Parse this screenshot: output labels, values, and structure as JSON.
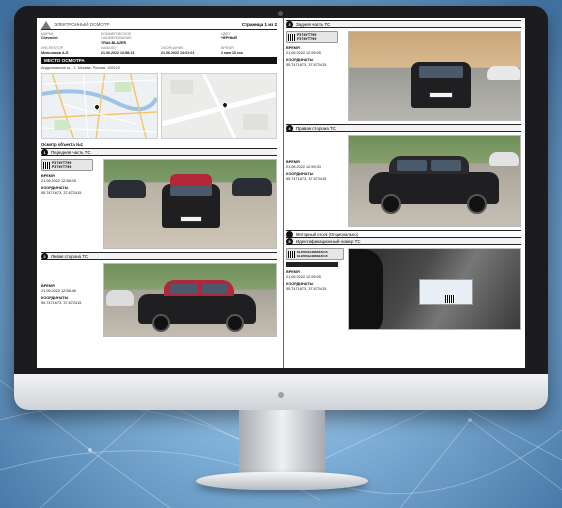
{
  "header": {
    "brand": "ЭЛЕКТРОННЫЙ ОСМОТР",
    "page": "Страница 1 из 2"
  },
  "meta": [
    {
      "label": "Марка",
      "value": "Chevrolet"
    },
    {
      "label": "Коммерческое наименование",
      "value": "TRAILBLAZER"
    },
    {
      "label": "",
      "value": ""
    },
    {
      "label": "Цвет",
      "value": "ЧЕРНЫЙ"
    },
    {
      "label": "Инспектор",
      "value": "Мельников А.Л."
    },
    {
      "label": "Начало",
      "value": "21.06.2022 12:58:13"
    },
    {
      "label": "Окончание",
      "value": "21.06.2022 13:01:01"
    },
    {
      "label": "Время",
      "value": "2 мин 10 сек"
    }
  ],
  "place": {
    "title": "МЕСТО ОСМОТРА",
    "address": "Андроновское ш., 2, Москва, Россия, 105120"
  },
  "object_label": "Осмотр объекта №1",
  "photos": [
    {
      "num": "1",
      "title": "Передняя часть ТС",
      "plate1": "P376YT799",
      "plate2": "P376YT799",
      "time_label": "ВРЕМЯ",
      "time": "21.06.2022 12:58:05",
      "coords_label": "КООРДИНАТЫ",
      "coords": "55.747167З, 37.672415"
    },
    {
      "num": "2",
      "title": "Левая сторона ТС",
      "time_label": "ВРЕМЯ",
      "time": "21.06.2022 12:58:46",
      "coords_label": "КООРДИНАТЫ",
      "coords": "55.747167З, 37.672415"
    },
    {
      "num": "3",
      "title": "Задняя часть ТС",
      "plate1": "P376YT799",
      "plate2": "P376YT799",
      "time_label": "ВРЕМЯ",
      "time": "21.06.2022 12:59:05",
      "coords_label": "КООРДИНАТЫ",
      "coords": "55.747167З, 37.672415"
    },
    {
      "num": "4",
      "title": "Правая сторона ТС",
      "time_label": "ВРЕМЯ",
      "time": "21.06.2022 12:59:33",
      "coords_label": "КООРДИНАТЫ",
      "coords": "55.747167З, 37.672415"
    },
    {
      "num": "5",
      "title": "Идентификационный номер ТС",
      "vin1": "KL1PD6GL9NB016615",
      "vin2": "KL1PD6GL9NB016615",
      "time_label": "ВРЕМЯ",
      "time": "21.06.2022 12:59:05",
      "coords_label": "КООРДИНАТЫ",
      "coords": "55.747167З, 37.672415"
    }
  ],
  "engine_note": "Моторный отсек (Опционально)",
  "colors": {
    "bezel": "#1c1c1e",
    "section_bar": "#111111",
    "car_red": "#b3263a",
    "background_blue": "#7fb0d8"
  }
}
